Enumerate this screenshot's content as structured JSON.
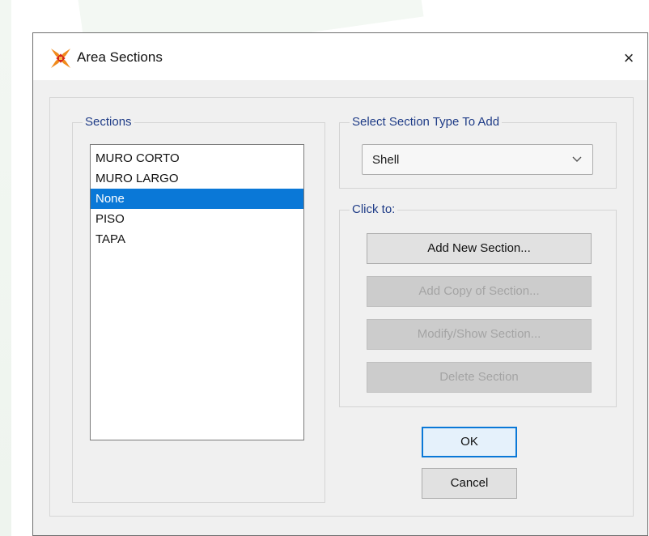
{
  "window": {
    "title": "Area Sections",
    "close_glyph": "×"
  },
  "sections_group": {
    "label": "Sections",
    "items": [
      {
        "label": "MURO CORTO",
        "selected": false
      },
      {
        "label": "MURO LARGO",
        "selected": false
      },
      {
        "label": "None",
        "selected": true
      },
      {
        "label": "PISO",
        "selected": false
      },
      {
        "label": "TAPA",
        "selected": false
      }
    ]
  },
  "type_group": {
    "label": "Select Section Type To Add",
    "selected_value": "Shell"
  },
  "click_group": {
    "label": "Click to:",
    "add_new": "Add New Section...",
    "add_copy": "Add Copy of Section...",
    "modify_show": "Modify/Show Section...",
    "delete": "Delete Section"
  },
  "dialog_buttons": {
    "ok": "OK",
    "cancel": "Cancel"
  },
  "colors": {
    "selection": "#0a78d7",
    "group_label": "#1f3c87",
    "icon_orange": "#f08a1c",
    "icon_red": "#d8261a"
  }
}
